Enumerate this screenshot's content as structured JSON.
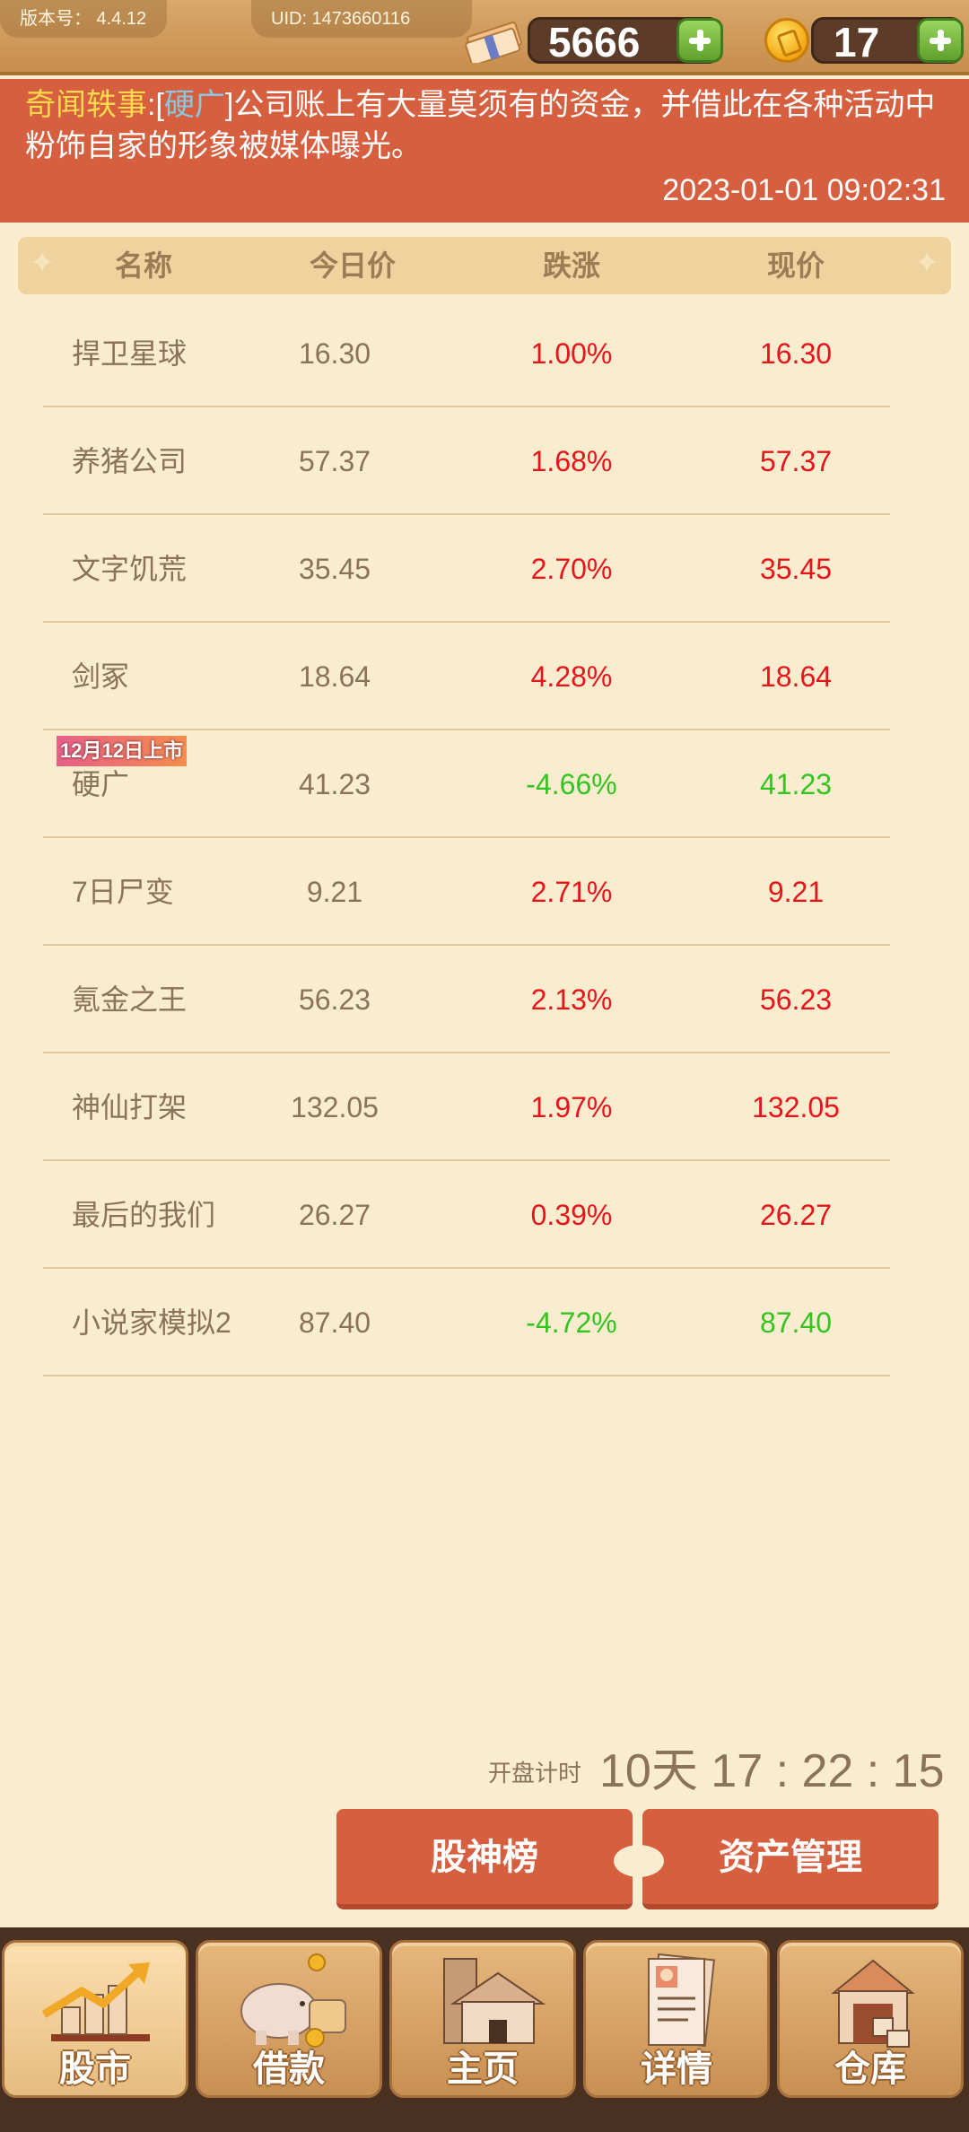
{
  "top_bar": {
    "version": "版本号： 4.4.12",
    "uid": "UID: 1473660116",
    "money": "5666",
    "coins": "17"
  },
  "news": {
    "tag": "奇闻轶事",
    "colon": ":[",
    "company": "硬广",
    "text": "]公司账上有大量莫须有的资金，并借此在各种活动中粉饰自家的形象被媒体曝光。",
    "timestamp": "2023-01-01 09:02:31"
  },
  "table": {
    "headers": {
      "name": "名称",
      "today": "今日价",
      "change": "跌涨",
      "current": "现价"
    },
    "rows": [
      {
        "name": "捍卫星球",
        "today": "16.30",
        "change": "1.00%",
        "current": "16.30",
        "trend": "up"
      },
      {
        "name": "养猪公司",
        "today": "57.37",
        "change": "1.68%",
        "current": "57.37",
        "trend": "up"
      },
      {
        "name": "文字饥荒",
        "today": "35.45",
        "change": "2.70%",
        "current": "35.45",
        "trend": "up"
      },
      {
        "name": "剑冢",
        "today": "18.64",
        "change": "4.28%",
        "current": "18.64",
        "trend": "up"
      },
      {
        "name": "硬广",
        "today": "41.23",
        "change": "-4.66%",
        "current": "41.23",
        "trend": "down",
        "badge": "12月12日上市"
      },
      {
        "name": "7日尸变",
        "today": "9.21",
        "change": "2.71%",
        "current": "9.21",
        "trend": "up"
      },
      {
        "name": "氪金之王",
        "today": "56.23",
        "change": "2.13%",
        "current": "56.23",
        "trend": "up"
      },
      {
        "name": "神仙打架",
        "today": "132.05",
        "change": "1.97%",
        "current": "132.05",
        "trend": "up"
      },
      {
        "name": "最后的我们",
        "today": "26.27",
        "change": "0.39%",
        "current": "26.27",
        "trend": "up"
      },
      {
        "name": "小说家模拟2",
        "today": "87.40",
        "change": "-4.72%",
        "current": "87.40",
        "trend": "down"
      }
    ]
  },
  "countdown": {
    "label": "开盘计时",
    "value": "10天 17 : 22 : 15"
  },
  "buttons": {
    "rank": "股神榜",
    "assets": "资产管理"
  },
  "nav": {
    "items": [
      {
        "label": "股市",
        "icon": "stock-chart-icon"
      },
      {
        "label": "借款",
        "icon": "piggy-bank-icon"
      },
      {
        "label": "主页",
        "icon": "house-icon"
      },
      {
        "label": "详情",
        "icon": "profile-document-icon"
      },
      {
        "label": "仓库",
        "icon": "warehouse-icon"
      }
    ]
  },
  "colors": {
    "up": "#e8141a",
    "down": "#33c41f",
    "banner": "#d55f3f",
    "accent": "#d55f3f"
  }
}
